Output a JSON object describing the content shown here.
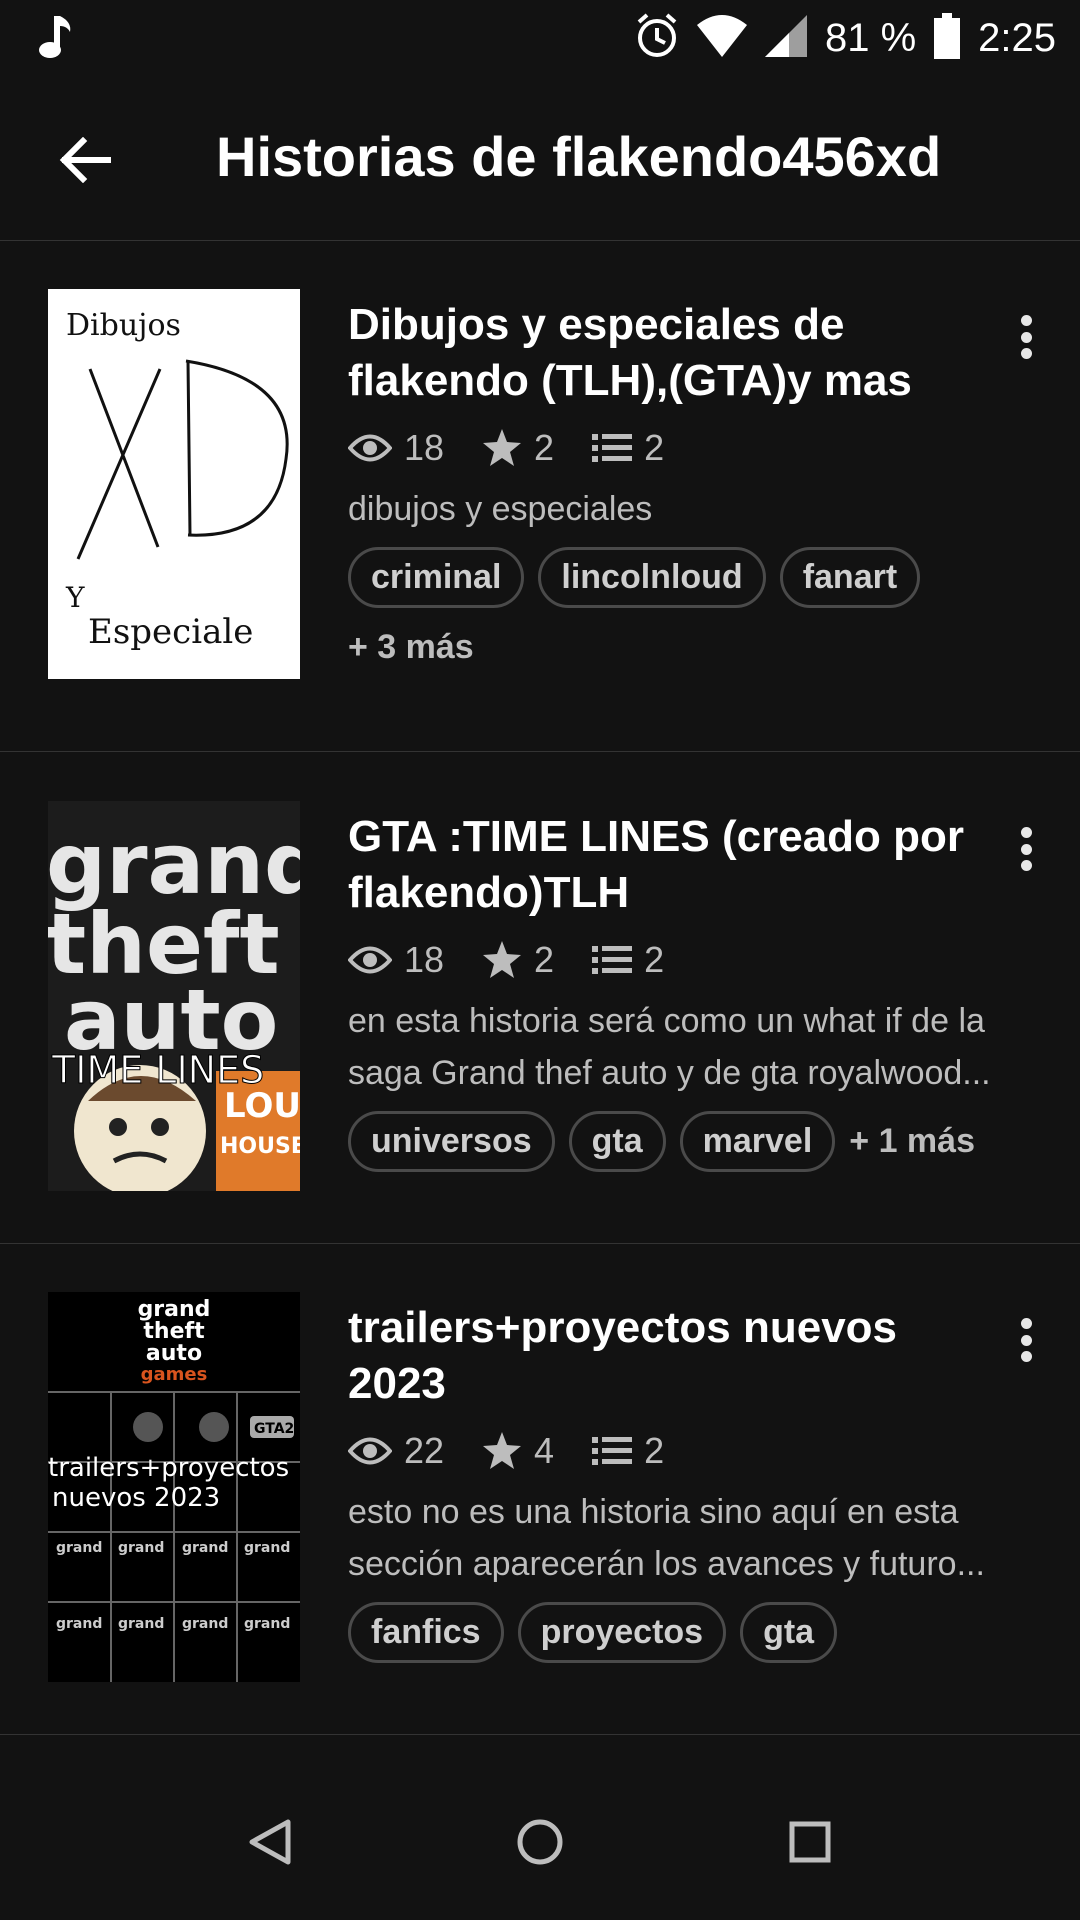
{
  "status_bar": {
    "battery": "81 %",
    "time": "2:25",
    "icons": [
      "music-note-icon",
      "alarm-icon",
      "wifi-icon",
      "signal-icon",
      "battery-icon"
    ]
  },
  "app_bar": {
    "title": "Historias de flakendo456xd",
    "back_icon": "arrow-back-icon"
  },
  "stories": [
    {
      "title": "Dibujos y especiales de flakendo (TLH),(GTA)y mas",
      "reads": "18",
      "votes": "2",
      "parts": "2",
      "description": "dibujos y especiales",
      "tags": [
        "criminal",
        "lincolnloud",
        "fanart"
      ],
      "more": "+ 3 más",
      "cover": {
        "line1": "Dibujos",
        "big": "XD",
        "line3": "Y",
        "line4": "Especiale"
      }
    },
    {
      "title": "GTA :TIME LINES (creado por flakendo)TLH",
      "reads": "18",
      "votes": "2",
      "parts": "2",
      "description": "en esta historia será como un what if de la saga Grand thef auto y de gta royalwood...",
      "tags": [
        "universos",
        "gta",
        "marvel"
      ],
      "more": "+ 1 más",
      "cover": {
        "l1": "grand",
        "l2": "theft",
        "l3": "auto",
        "l4": "TIME LINES",
        "l5": "LOUD",
        "l6": "HOUSE"
      }
    },
    {
      "title": "trailers+proyectos nuevos 2023",
      "reads": "22",
      "votes": "4",
      "parts": "2",
      "description": "esto no es una historia sino aquí en esta sección aparecerán los avances y futuro...",
      "tags": [
        "fanfics",
        "proyectos",
        "gta"
      ],
      "more": "",
      "cover": {
        "l1": "grand",
        "l2": "theft",
        "l3": "auto",
        "l4": "games",
        "caption1": "trailers+proyectos",
        "caption2": "nuevos 2023",
        "badge": "GTA2"
      }
    }
  ],
  "nav_bar": {
    "icons": [
      "nav-back-icon",
      "nav-home-icon",
      "nav-recents-icon"
    ]
  }
}
